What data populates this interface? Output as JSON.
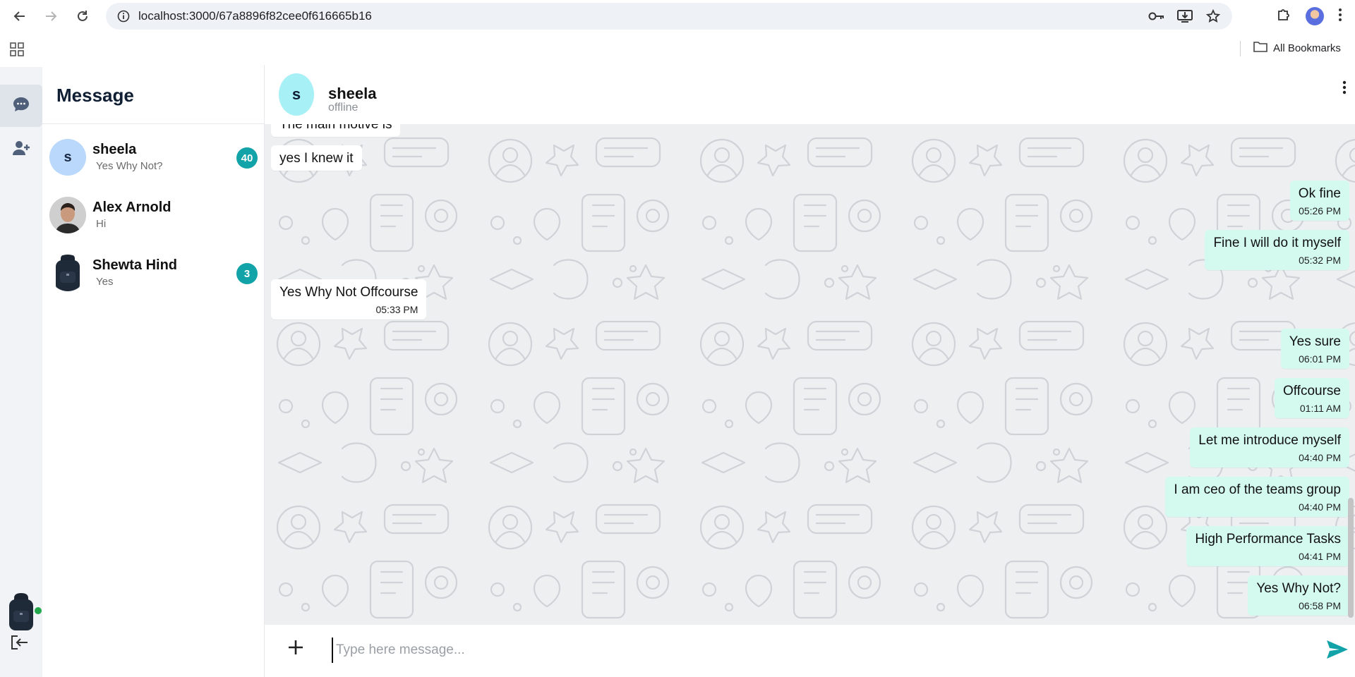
{
  "browser": {
    "url": "localhost:3000/67a8896f82cee0f616665b16",
    "bookmarks_label": "All Bookmarks"
  },
  "sidebar": {
    "title": "Message",
    "contacts": [
      {
        "name": "sheela",
        "preview": "Yes Why Not?",
        "avatar_letter": "s",
        "unread": "40"
      },
      {
        "name": "Alex Arnold",
        "preview": "Hi",
        "unread": ""
      },
      {
        "name": "Shewta Hind",
        "preview": "Yes",
        "unread": "3"
      }
    ]
  },
  "chat": {
    "name": "sheela",
    "avatar_letter": "s",
    "status": "offline",
    "messages": [
      {
        "dir": "in",
        "text": "The main motive is",
        "time": ""
      },
      {
        "dir": "in",
        "text": "yes I knew it",
        "time": ""
      },
      {
        "dir": "out",
        "text": "Ok fine",
        "time": "05:26 PM"
      },
      {
        "dir": "out",
        "text": "Fine I will do it myself",
        "time": "05:32 PM"
      },
      {
        "dir": "in",
        "text": "Yes Why Not Offcourse",
        "time": "05:33 PM"
      },
      {
        "dir": "out",
        "text": "Yes sure",
        "time": "06:01 PM"
      },
      {
        "dir": "out",
        "text": "Offcourse",
        "time": "01:11 AM"
      },
      {
        "dir": "out",
        "text": "Let me introduce myself",
        "time": "04:40 PM"
      },
      {
        "dir": "out",
        "text": "I am ceo of the teams group",
        "time": "04:40 PM"
      },
      {
        "dir": "out",
        "text": "High Performance Tasks",
        "time": "04:41 PM"
      },
      {
        "dir": "out",
        "text": "Yes Why Not?",
        "time": "06:58 PM"
      }
    ]
  },
  "composer": {
    "placeholder": "Type here message...",
    "value": ""
  },
  "colors": {
    "accent": "#12a3a8",
    "outgoing_bubble": "#d4faf0",
    "incoming_bubble": "#ffffff",
    "chat_background": "#eeeff1",
    "online": "#22a84a"
  },
  "icons": {
    "back": "back-arrow-icon",
    "forward": "forward-arrow-icon",
    "reload": "reload-icon",
    "site_info": "site-info-icon",
    "password": "key-icon",
    "install": "install-icon",
    "bookmark": "star-icon",
    "extensions": "puzzle-icon",
    "browser_menu": "kebab-icon",
    "apps": "apps-grid-icon",
    "folder": "folder-icon",
    "chats": "chat-bubble-icon",
    "add_user": "add-user-icon",
    "logout": "logout-icon",
    "chat_menu": "kebab-icon",
    "attach": "plus-icon",
    "send": "send-icon"
  }
}
